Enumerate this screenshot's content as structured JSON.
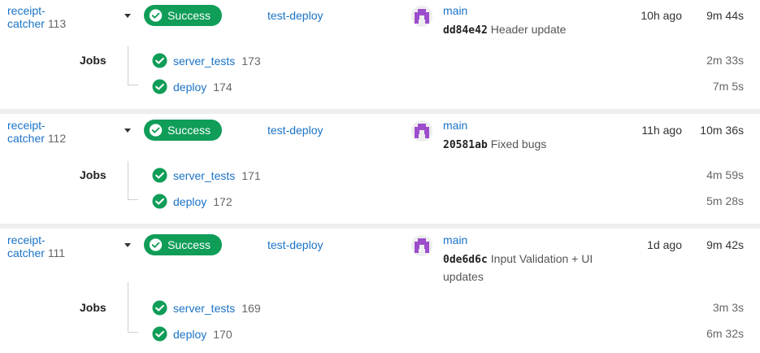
{
  "colors": {
    "success_green": "#0f9d58",
    "link_blue": "#1a73c7",
    "separator": "#eeeeee",
    "avatar_purple": "#9c4dcc"
  },
  "runs": [
    {
      "pipeline_line1": "receipt-",
      "pipeline_line2": "catcher",
      "number": "113",
      "status": "Success",
      "status_icon": "check-circle-icon",
      "environment": "test-deploy",
      "branch": "main",
      "sha": "dd84e42",
      "message": "Header update",
      "time_ago": "10h ago",
      "duration": "9m 44s",
      "jobs_label": "Jobs",
      "jobs": [
        {
          "name": "server_tests",
          "number": "173",
          "duration": "2m 33s"
        },
        {
          "name": "deploy",
          "number": "174",
          "duration": "7m 5s"
        }
      ]
    },
    {
      "pipeline_line1": "receipt-",
      "pipeline_line2": "catcher",
      "number": "112",
      "status": "Success",
      "status_icon": "check-circle-icon",
      "environment": "test-deploy",
      "branch": "main",
      "sha": "20581ab",
      "message": "Fixed bugs",
      "time_ago": "11h ago",
      "duration": "10m 36s",
      "jobs_label": "Jobs",
      "jobs": [
        {
          "name": "server_tests",
          "number": "171",
          "duration": "4m 59s"
        },
        {
          "name": "deploy",
          "number": "172",
          "duration": "5m 28s"
        }
      ]
    },
    {
      "pipeline_line1": "receipt-",
      "pipeline_line2": "catcher",
      "number": "111",
      "status": "Success",
      "status_icon": "check-circle-icon",
      "environment": "test-deploy",
      "branch": "main",
      "sha": "0de6d6c",
      "message": "Input Validation + UI updates",
      "time_ago": "1d ago",
      "duration": "9m 42s",
      "jobs_label": "Jobs",
      "jobs": [
        {
          "name": "server_tests",
          "number": "169",
          "duration": "3m 3s"
        },
        {
          "name": "deploy",
          "number": "170",
          "duration": "6m 32s"
        }
      ]
    }
  ]
}
